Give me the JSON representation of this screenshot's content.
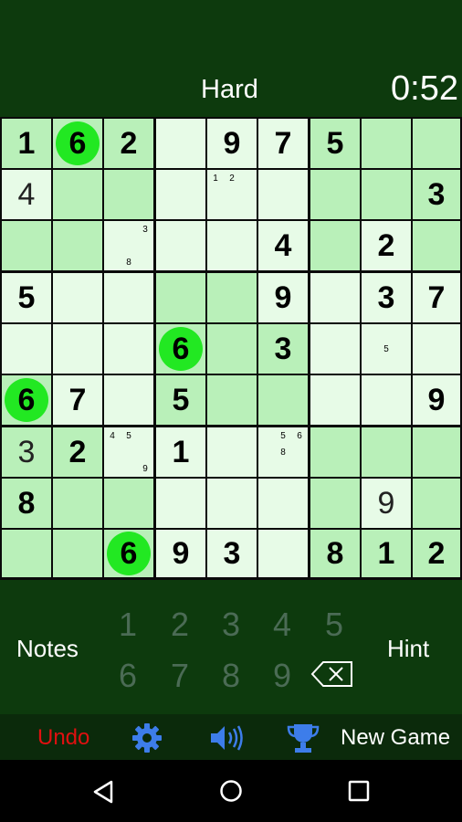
{
  "header": {
    "difficulty": "Hard",
    "timer": "0:52"
  },
  "board": {
    "cells": [
      [
        {
          "v": "1",
          "g": true
        },
        {
          "v": "6",
          "g": true,
          "hl": true
        },
        {
          "v": "2",
          "g": true
        },
        {},
        {
          "v": "9",
          "g": true
        },
        {
          "v": "7",
          "g": true
        },
        {
          "v": "5",
          "g": true
        },
        {},
        {}
      ],
      [
        {
          "v": "4",
          "e": true
        },
        {},
        {},
        {},
        {
          "notes": [
            "1",
            "2",
            "",
            "",
            "",
            "",
            "",
            "",
            ""
          ]
        },
        {},
        {},
        {},
        {
          "v": "3",
          "g": true
        }
      ],
      [
        {},
        {},
        {
          "notes": [
            "",
            "",
            "3",
            "",
            "",
            "",
            "",
            "8",
            ""
          ]
        },
        {},
        {},
        {
          "v": "4",
          "g": true
        },
        {},
        {
          "v": "2",
          "g": true
        },
        {}
      ],
      [
        {
          "v": "5",
          "g": true
        },
        {},
        {},
        {},
        {},
        {
          "v": "9",
          "g": true
        },
        {},
        {
          "v": "3",
          "g": true
        },
        {
          "v": "7",
          "g": true
        }
      ],
      [
        {},
        {},
        {},
        {
          "v": "6",
          "g": true,
          "hl": true
        },
        {},
        {
          "v": "3",
          "g": true
        },
        {},
        {
          "notes": [
            "",
            "",
            "",
            "",
            "5",
            "",
            "",
            "",
            ""
          ]
        },
        {}
      ],
      [
        {
          "v": "6",
          "g": true,
          "hl": true
        },
        {
          "v": "7",
          "g": true
        },
        {},
        {
          "v": "5",
          "g": true
        },
        {},
        {},
        {},
        {},
        {
          "v": "9",
          "g": true
        }
      ],
      [
        {
          "v": "3",
          "e": true
        },
        {
          "v": "2",
          "g": true
        },
        {
          "notes": [
            "4",
            "5",
            "",
            "",
            "",
            "",
            "",
            "",
            "9"
          ]
        },
        {
          "v": "1",
          "g": true
        },
        {},
        {
          "notes": [
            "",
            "5",
            "6",
            "",
            "8",
            "",
            "",
            "",
            ""
          ]
        },
        {},
        {},
        {}
      ],
      [
        {
          "v": "8",
          "g": true
        },
        {},
        {},
        {},
        {},
        {},
        {},
        {
          "v": "9",
          "e": true
        },
        {}
      ],
      [
        {},
        {},
        {
          "v": "6",
          "g": true,
          "hl": true
        },
        {
          "v": "9",
          "g": true
        },
        {
          "v": "3",
          "g": true
        },
        {},
        {
          "v": "8",
          "g": true
        },
        {
          "v": "1",
          "g": true
        },
        {
          "v": "2",
          "g": true
        }
      ]
    ],
    "shade": [
      [
        1,
        1,
        1,
        0,
        0,
        0,
        1,
        1,
        1
      ],
      [
        0,
        1,
        1,
        0,
        0,
        0,
        1,
        1,
        1
      ],
      [
        1,
        1,
        0,
        0,
        0,
        0,
        1,
        0,
        1
      ],
      [
        0,
        0,
        0,
        1,
        1,
        0,
        0,
        0,
        0
      ],
      [
        0,
        0,
        0,
        1,
        1,
        1,
        0,
        0,
        0
      ],
      [
        1,
        0,
        0,
        1,
        1,
        1,
        0,
        0,
        0
      ],
      [
        1,
        1,
        0,
        0,
        0,
        0,
        1,
        1,
        1
      ],
      [
        1,
        1,
        1,
        0,
        0,
        0,
        1,
        0,
        1
      ],
      [
        1,
        1,
        1,
        0,
        0,
        0,
        1,
        1,
        1
      ]
    ]
  },
  "controls": {
    "notes_label": "Notes",
    "hint_label": "Hint",
    "numbers": [
      "1",
      "2",
      "3",
      "4",
      "5",
      "6",
      "7",
      "8",
      "9"
    ],
    "erase_icon": "backspace-icon"
  },
  "toolbar": {
    "undo_label": "Undo",
    "settings_icon": "gear-icon",
    "sound_icon": "speaker-icon",
    "trophy_icon": "trophy-icon",
    "new_game_label": "New Game",
    "undo_color": "#e01010",
    "icon_color": "#3d7dea"
  },
  "nav": {
    "back_icon": "back-icon",
    "home_icon": "home-icon",
    "recents_icon": "recents-icon"
  }
}
